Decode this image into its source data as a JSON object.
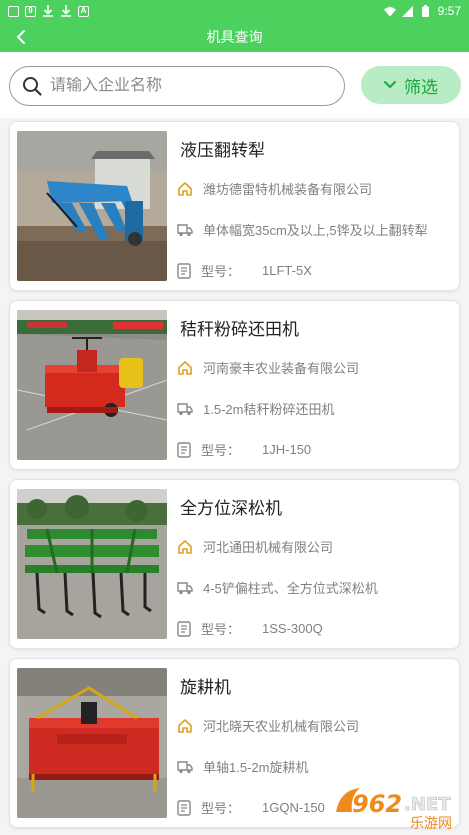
{
  "status_bar": {
    "time": "9:57"
  },
  "header": {
    "title": "机具查询"
  },
  "search": {
    "placeholder": "请输入企业名称",
    "filter_label": "筛选"
  },
  "model_prefix": "型号：",
  "items": [
    {
      "title": "液压翻转犁",
      "company": "潍坊德雷特机械装备有限公司",
      "desc": "单体幅宽35cm及以上,5铧及以上翻转犁",
      "model": "1LFT-5X"
    },
    {
      "title": "秸秆粉碎还田机",
      "company": "河南豪丰农业装备有限公司",
      "desc": "1.5-2m秸秆粉碎还田机",
      "model": "1JH-150"
    },
    {
      "title": "全方位深松机",
      "company": "河北通田机械有限公司",
      "desc": "4-5铲偏柱式、全方位式深松机",
      "model": "1SS-300Q"
    },
    {
      "title": "旋耕机",
      "company": "河北晓天农业机械有限公司",
      "desc": "单轴1.5-2m旋耕机",
      "model": "1GQN-150"
    }
  ],
  "watermark": {
    "brand": "962.NET",
    "subtitle": "乐游网"
  },
  "colors": {
    "primary": "#4cd15f",
    "filter_bg": "#b8ecc4",
    "filter_text": "#1aa83a",
    "company_icon": "#e0a020"
  },
  "icons": {
    "back": "chevron-left-icon",
    "search": "search-icon",
    "filter": "chevron-down-icon",
    "company": "home-icon",
    "desc": "truck-icon",
    "model": "document-icon"
  }
}
